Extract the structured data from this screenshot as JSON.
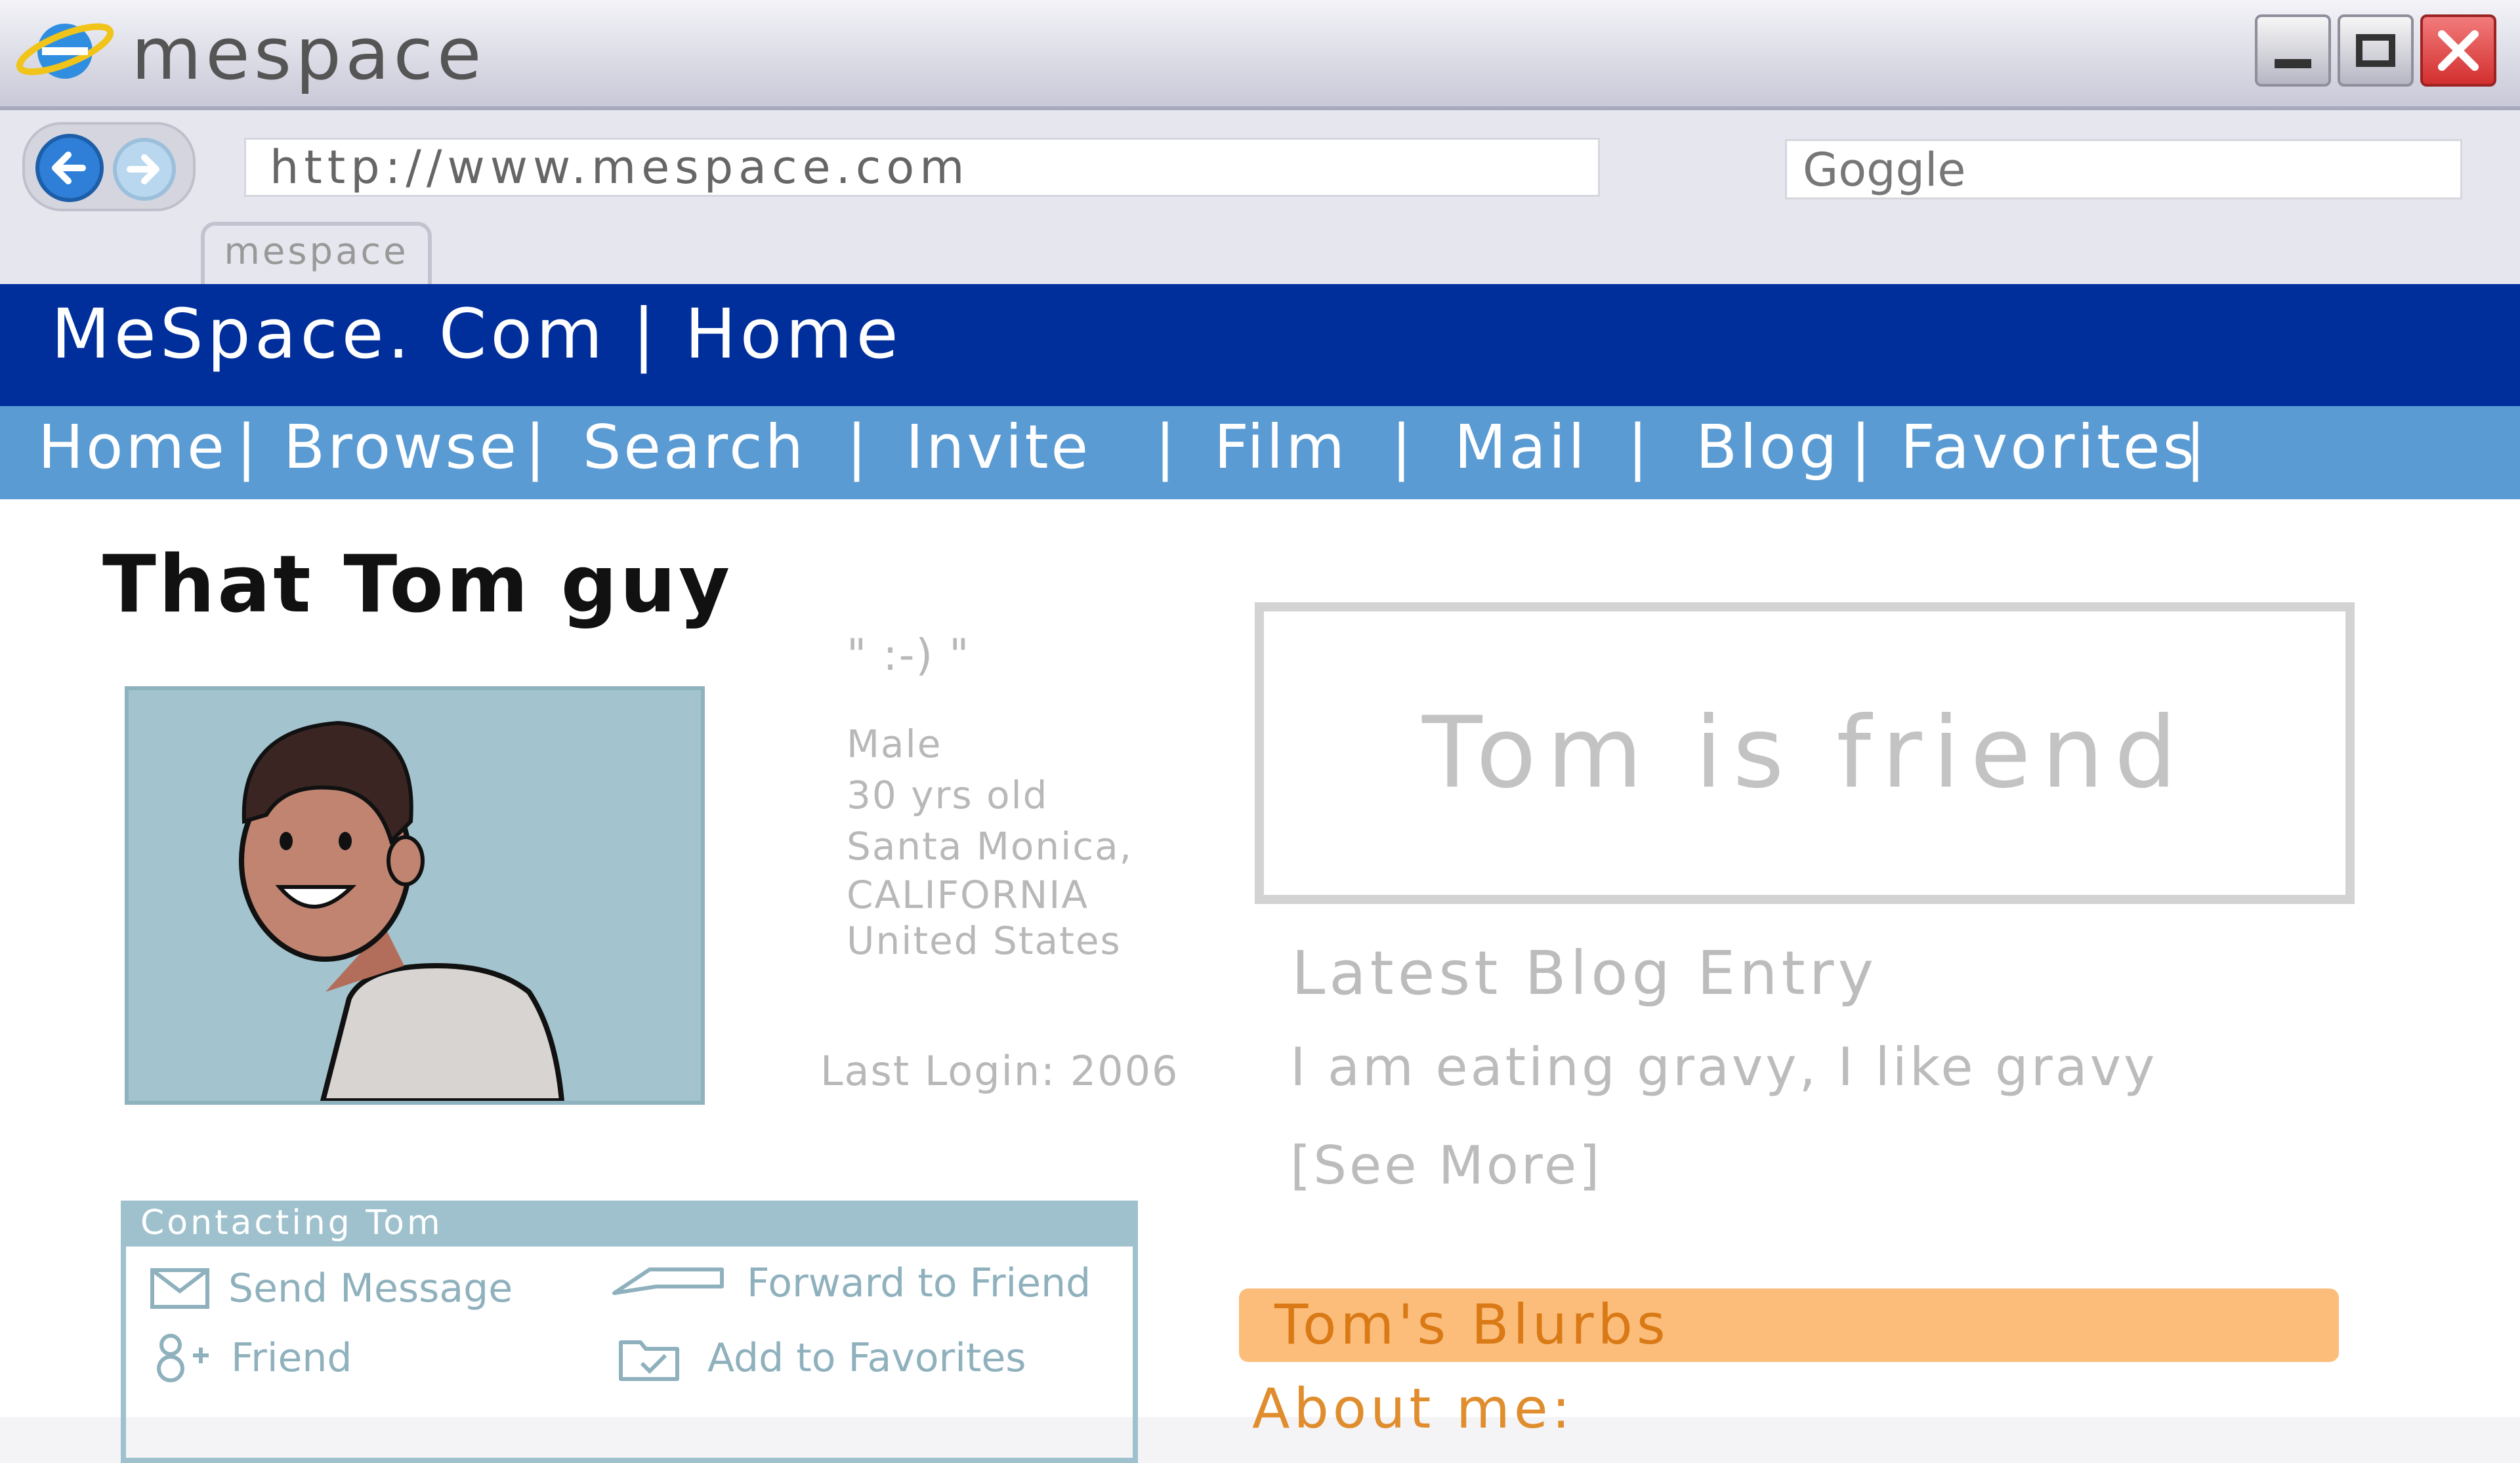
{
  "window": {
    "title": "mespace",
    "controls": [
      "minimize",
      "maximize",
      "close"
    ],
    "icons": {
      "browser": "browser-logo-icon",
      "back": "back-arrow-icon",
      "forward": "forward-arrow-icon"
    }
  },
  "browser": {
    "url": "http://www.mespace.com",
    "search_value": "Goggle",
    "tab_label": "mespace"
  },
  "site": {
    "header_title": "MeSpace. Com | Home",
    "nav": [
      "Home",
      "Browse",
      "Search",
      "Invite",
      "Film",
      "Mail",
      "Blog",
      "Favorites"
    ]
  },
  "profile": {
    "name": "That Tom guy",
    "mood": "\" :-) \"",
    "gender": "Male",
    "age": "30 yrs old",
    "city": "Santa Monica,",
    "state": "CALIFORNIA",
    "country": "United States",
    "last_login": "Last Login: 2006"
  },
  "friend_box": {
    "text": "Tom is friend"
  },
  "blog": {
    "heading": "Latest Blog Entry",
    "entry": "I am eating gravy, I like gravy",
    "see_more": "[See More]"
  },
  "contacting": {
    "title": "Contacting Tom",
    "actions": [
      {
        "label": "Send Message",
        "icon": "envelope-icon"
      },
      {
        "label": "Forward to Friend",
        "icon": "forward-arrow-icon"
      },
      {
        "label": "Friend",
        "icon": "add-friend-icon"
      },
      {
        "label": "Add to Favorites",
        "icon": "folder-check-icon"
      }
    ]
  },
  "blurbs": {
    "title": "Tom's Blurbs",
    "about": "About me:"
  },
  "colors": {
    "site_header": "#002f9c",
    "nav_bar": "#5b9bd3",
    "blurbs_bar": "#fcbd7b",
    "contact_border": "#9ec1cd"
  }
}
